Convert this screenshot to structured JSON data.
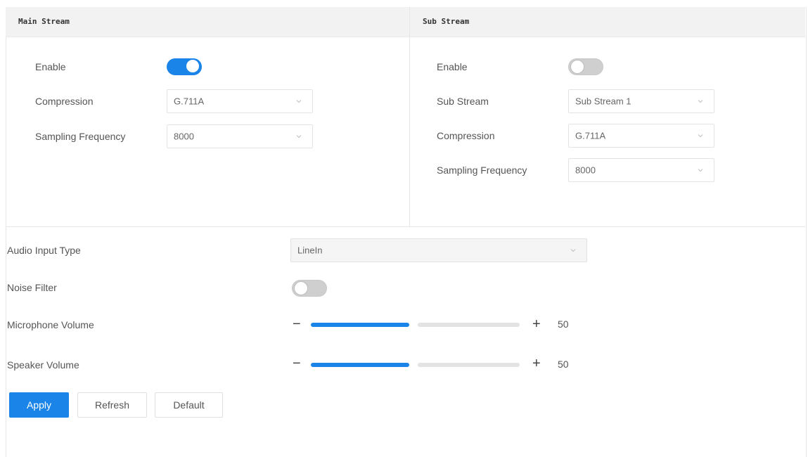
{
  "main_stream": {
    "title": "Main Stream",
    "enable_label": "Enable",
    "enable_on": true,
    "compression_label": "Compression",
    "compression_value": "G.711A",
    "sampling_label": "Sampling Frequency",
    "sampling_value": "8000"
  },
  "sub_stream": {
    "title": "Sub Stream",
    "enable_label": "Enable",
    "enable_on": false,
    "stream_label": "Sub Stream",
    "stream_value": "Sub Stream 1",
    "compression_label": "Compression",
    "compression_value": "G.711A",
    "sampling_label": "Sampling Frequency",
    "sampling_value": "8000"
  },
  "audio_input": {
    "label": "Audio Input  Type",
    "value": "LineIn"
  },
  "noise_filter": {
    "label": "Noise Filter",
    "on": false
  },
  "microphone_volume": {
    "label": "Microphone Volume",
    "value": "50"
  },
  "speaker_volume": {
    "label": "Speaker Volume",
    "value": "50"
  },
  "buttons": {
    "apply": "Apply",
    "refresh": "Refresh",
    "default": "Default"
  },
  "colors": {
    "accent": "#1a84e8",
    "header_bg": "#f2f2f2"
  },
  "icons": {
    "dropdown": "chevron-down-icon",
    "minus": "minus-icon",
    "plus": "plus-icon"
  }
}
